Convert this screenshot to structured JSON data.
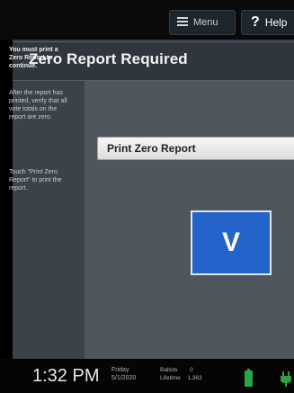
{
  "topbar": {
    "menu_label": "Menu",
    "help_label": "Help"
  },
  "title": "Zero Report Required",
  "sidebar": {
    "strong": "You must print a Zero Report to continue.",
    "para1": "After the report has printed, verify that all vote totals on the report are zero.",
    "para2": "Touch \"Print Zero Report\" to print the report."
  },
  "main": {
    "print_button": "Print Zero Report",
    "v_logo": "V"
  },
  "status": {
    "time": "1:32 PM",
    "day": "Friday",
    "date": "5/1/2020",
    "ballots_label": "Ballots",
    "ballots_value": "0",
    "lifetime_label": "Lifetime",
    "lifetime_value": "1,363"
  },
  "colors": {
    "accent": "#2463c9",
    "battery": "#23a84a",
    "panel": "#353c44"
  },
  "icons": [
    "menu-icon",
    "help-icon",
    "battery-icon",
    "power-plug-icon"
  ]
}
